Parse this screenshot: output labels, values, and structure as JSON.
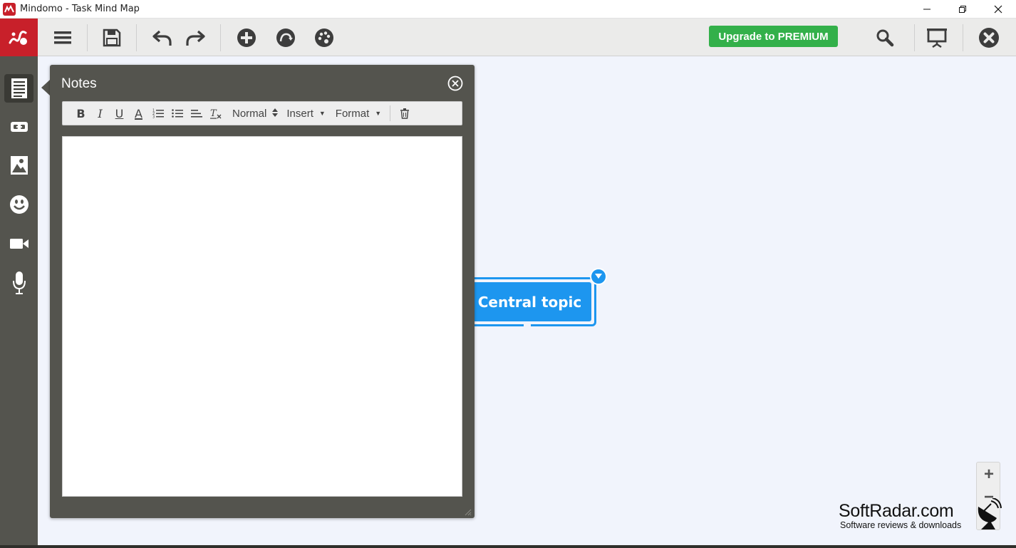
{
  "window": {
    "title": "Mindomo - Task Mind Map",
    "controls": [
      "minimize",
      "restore",
      "close"
    ]
  },
  "toolbar": {
    "buttons": [
      "menu",
      "save",
      "undo",
      "redo",
      "add-topic",
      "relationship",
      "theme"
    ],
    "premium_label": "Upgrade to PREMIUM",
    "right_buttons": [
      "search",
      "presentation",
      "close"
    ],
    "colors": {
      "premium": "#33b04a",
      "brand": "#c8202a"
    }
  },
  "sidebar": {
    "items": [
      {
        "icon": "notes-icon",
        "active": true
      },
      {
        "icon": "link-icon",
        "active": false
      },
      {
        "icon": "image-icon",
        "active": false
      },
      {
        "icon": "smiley-icon",
        "active": false
      },
      {
        "icon": "video-icon",
        "active": false
      },
      {
        "icon": "microphone-icon",
        "active": false
      }
    ]
  },
  "notes_panel": {
    "title": "Notes",
    "toolbar": {
      "bold": "B",
      "italic": "I",
      "underline": "U",
      "text_color": "A",
      "format_select": "Normal",
      "insert_menu": "Insert",
      "format_menu": "Format"
    },
    "content": ""
  },
  "mindmap": {
    "central_topic": "Central topic",
    "topic_color": "#1d96ef"
  },
  "zoom": {
    "in_label": "+",
    "out_label": "−"
  },
  "watermark": {
    "main": "SoftRadar.com",
    "sub": "Software reviews & downloads"
  }
}
